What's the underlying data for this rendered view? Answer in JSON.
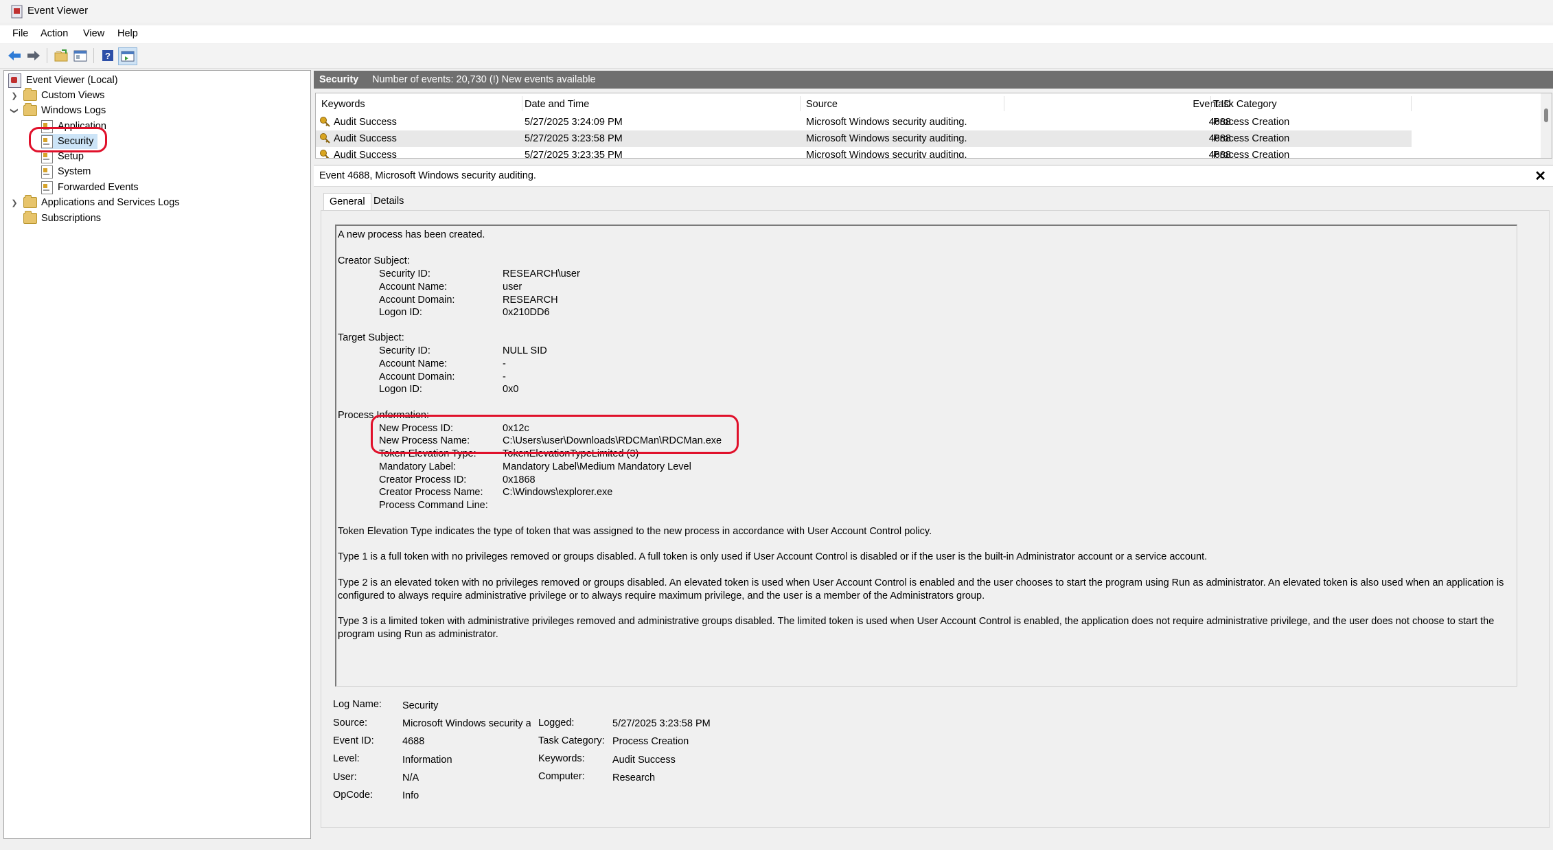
{
  "window": {
    "title": "Event Viewer"
  },
  "menu": [
    "File",
    "Action",
    "View",
    "Help"
  ],
  "toolbar": {
    "icons": [
      "back-arrow-icon",
      "forward-arrow-icon",
      "open-folder-icon",
      "properties-icon",
      "help-icon",
      "show-pane-icon"
    ]
  },
  "tree": {
    "root": "Event Viewer (Local)",
    "custom_views": "Custom Views",
    "windows_logs": "Windows Logs",
    "application": "Application",
    "security": "Security",
    "setup": "Setup",
    "system": "System",
    "forwarded": "Forwarded Events",
    "apps_services": "Applications and Services Logs",
    "subscriptions": "Subscriptions"
  },
  "header": {
    "log_name": "Security",
    "info": "Number of events: 20,730 (!) New events available"
  },
  "list": {
    "columns": [
      "Keywords",
      "Date and Time",
      "Source",
      "Event ID",
      "Task Category"
    ],
    "rows": [
      {
        "keywords": "Audit Success",
        "date": "5/27/2025 3:24:09 PM",
        "source": "Microsoft Windows security auditing.",
        "event_id": "4688",
        "category": "Process Creation"
      },
      {
        "keywords": "Audit Success",
        "date": "5/27/2025 3:23:58 PM",
        "source": "Microsoft Windows security auditing.",
        "event_id": "4688",
        "category": "Process Creation"
      },
      {
        "keywords": "Audit Success",
        "date": "5/27/2025 3:23:35 PM",
        "source": "Microsoft Windows security auditing.",
        "event_id": "4688",
        "category": "Process Creation"
      }
    ]
  },
  "detail": {
    "title": "Event 4688, Microsoft Windows security auditing.",
    "close": "✕",
    "tabs": [
      "General",
      "Details"
    ],
    "message": {
      "intro": "A new process has been created.",
      "creator_header": "Creator Subject:",
      "creator": [
        [
          "Security ID:",
          "RESEARCH\\user"
        ],
        [
          "Account Name:",
          "user"
        ],
        [
          "Account Domain:",
          "RESEARCH"
        ],
        [
          "Logon ID:",
          "0x210DD6"
        ]
      ],
      "target_header": "Target Subject:",
      "target": [
        [
          "Security ID:",
          "NULL SID"
        ],
        [
          "Account Name:",
          "-"
        ],
        [
          "Account Domain:",
          "-"
        ],
        [
          "Logon ID:",
          "0x0"
        ]
      ],
      "process_header": "Process Information:",
      "process": [
        [
          "New Process ID:",
          "0x12c"
        ],
        [
          "New Process Name:",
          "C:\\Users\\user\\Downloads\\RDCMan\\RDCMan.exe"
        ],
        [
          "Token Elevation Type:",
          "TokenElevationTypeLimited (3)"
        ],
        [
          "Mandatory Label:",
          "Mandatory Label\\Medium Mandatory Level"
        ],
        [
          "Creator Process ID:",
          "0x1868"
        ],
        [
          "Creator Process Name:",
          "C:\\Windows\\explorer.exe"
        ],
        [
          "Process Command Line:",
          ""
        ]
      ],
      "para1": "Token Elevation Type indicates the type of token that was assigned to the new process in accordance with User Account Control policy.",
      "para2": "Type 1 is a full token with no privileges removed or groups disabled.  A full token is only used if User Account Control is disabled or if the user is the built-in Administrator account or a service account.",
      "para3": "Type 2 is an elevated token with no privileges removed or groups disabled.  An elevated token is used when User Account Control is enabled and the user chooses to start the program using Run as administrator.  An elevated token is also used when an application is configured to always require administrative privilege or to always require maximum privilege, and the user is a member of the Administrators group.",
      "para4": "Type 3 is a limited token with administrative privileges removed and administrative groups disabled.  The limited token is used when User Account Control is enabled, the application does not require administrative privilege, and the user does not choose to start the program using Run as administrator."
    },
    "fields": {
      "log_name_label": "Log Name:",
      "log_name": "Security",
      "source_label": "Source:",
      "source": "Microsoft Windows security a",
      "logged_label": "Logged:",
      "logged": "5/27/2025 3:23:58 PM",
      "event_id_label": "Event ID:",
      "event_id": "4688",
      "task_label": "Task Category:",
      "task": "Process Creation",
      "level_label": "Level:",
      "level": "Information",
      "keywords_label": "Keywords:",
      "keywords": "Audit Success",
      "user_label": "User:",
      "user": "N/A",
      "computer_label": "Computer:",
      "computer": "Research",
      "opcode_label": "OpCode:",
      "opcode": "Info"
    }
  },
  "colors": {
    "annotation": "#e0102a",
    "header_bg": "#6f6f6f",
    "selection": "#cce4f7"
  }
}
